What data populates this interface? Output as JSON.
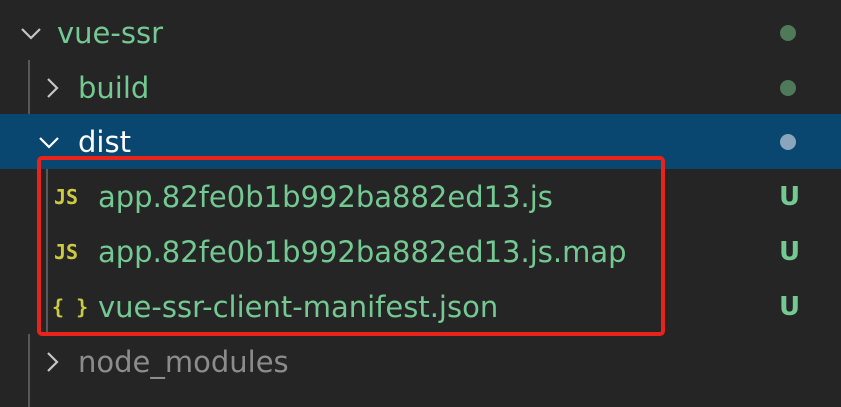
{
  "tree": {
    "rows": [
      {
        "label": "vue-ssr",
        "kind": "folder",
        "expanded": true,
        "color": "#73c991",
        "decoration": "dot",
        "decoration_color": "#4f7a5a"
      },
      {
        "label": "build",
        "kind": "folder",
        "expanded": false,
        "color": "#73c991",
        "decoration": "dot",
        "decoration_color": "#4f7a5a"
      },
      {
        "label": "dist",
        "kind": "folder",
        "expanded": true,
        "selected": true,
        "color": "#ffffff",
        "decoration": "dot",
        "decoration_color": "#8aa6bd"
      },
      {
        "label": "app.82fe0b1b992ba882ed13.js",
        "kind": "file",
        "icon": "javascript-file-icon",
        "icon_text": "JS",
        "icon_color": "#cbcb41",
        "color": "#73c991",
        "decoration": "U",
        "decoration_color": "#73c991"
      },
      {
        "label": "app.82fe0b1b992ba882ed13.js.map",
        "kind": "file",
        "icon": "javascript-file-icon",
        "icon_text": "JS",
        "icon_color": "#cbcb41",
        "color": "#73c991",
        "decoration": "U",
        "decoration_color": "#73c991"
      },
      {
        "label": "vue-ssr-client-manifest.json",
        "kind": "file",
        "icon": "json-file-icon",
        "icon_text": "{ }",
        "icon_color": "#cbcb41",
        "color": "#73c991",
        "decoration": "U",
        "decoration_color": "#73c991"
      },
      {
        "label": "node_modules",
        "kind": "folder",
        "expanded": false,
        "color": "#8c8c8c"
      }
    ]
  },
  "colors": {
    "background": "#252526",
    "selection": "#094771",
    "untracked": "#73c991",
    "annotation_box": "#e8231b"
  }
}
